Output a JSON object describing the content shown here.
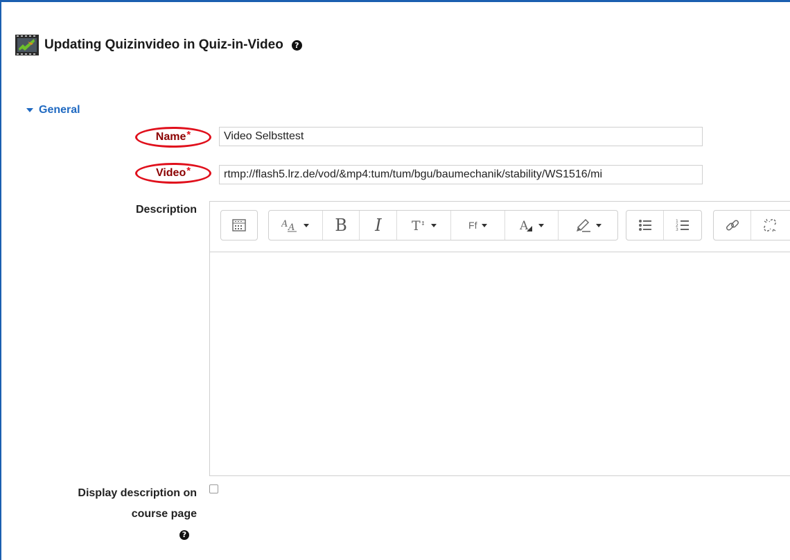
{
  "page": {
    "title": "Updating Quizinvideo in Quiz-in-Video",
    "help_glyph": "?"
  },
  "section": {
    "label": "General"
  },
  "fields": {
    "name": {
      "label": "Name",
      "required": "*",
      "value": "Video Selbsttest"
    },
    "video": {
      "label": "Video",
      "required": "*",
      "value": "rtmp://flash5.lrz.de/vod/&mp4:tum/tum/bgu/baumechanik/stability/WS1516/mi"
    },
    "description": {
      "label": "Description"
    },
    "display_description": {
      "label_line1": "Display description on",
      "label_line2": "course page",
      "checked": false
    }
  },
  "toolbar": {
    "icons": [
      "show-more-icon",
      "font-style-icon",
      "bold-icon",
      "italic-icon",
      "font-size-icon",
      "font-family-icon",
      "text-color-icon",
      "highlight-icon",
      "bullet-list-icon",
      "numbered-list-icon",
      "link-icon",
      "unlink-icon"
    ],
    "bold_glyph": "B",
    "italic_glyph": "I",
    "font_family_glyph": "Ff"
  },
  "colors": {
    "accent": "#1f69c1",
    "required": "#e0101c",
    "frame": "#1b5fb0"
  }
}
